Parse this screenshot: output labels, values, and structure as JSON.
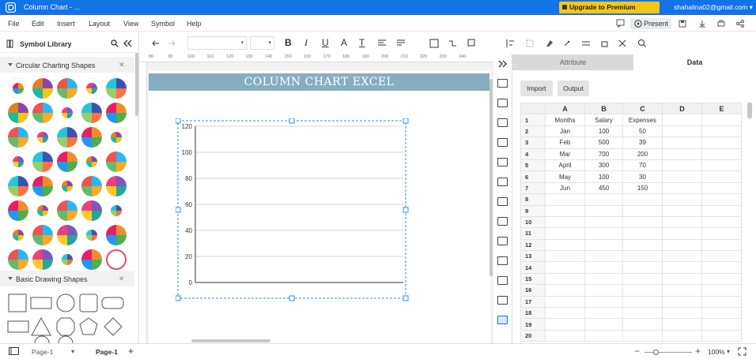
{
  "window": {
    "title": "Column Chart - ...",
    "premium_label": "Upgrade to Premium Version",
    "user_email": "shahalina02@gmail.com ▾"
  },
  "menu": [
    "File",
    "Edit",
    "Insert",
    "Layout",
    "View",
    "Symbol",
    "Help"
  ],
  "toolbar": {
    "present_label": "Present"
  },
  "symbol_library": {
    "title": "Symbol Library",
    "sections": [
      "Circular Charting Shapes",
      "Basic Drawing Shapes"
    ]
  },
  "canvas": {
    "banner_title": "COLUMN CHART EXCEL",
    "ruler_ticks": [
      "80",
      "90",
      "100",
      "110",
      "120",
      "130",
      "140",
      "150",
      "160",
      "170",
      "180",
      "190",
      "200",
      "210",
      "220",
      "230",
      "240"
    ]
  },
  "chart_data": {
    "type": "bar",
    "title": "",
    "categories": [],
    "series": [],
    "ylim": [
      0,
      120
    ],
    "yticks": [
      "120",
      "100",
      "80",
      "60",
      "40",
      "20",
      "0"
    ],
    "grid": true
  },
  "panel": {
    "tabs": [
      "Attribute",
      "Data"
    ],
    "import_label": "Import",
    "output_label": "Output",
    "columns": [
      "A",
      "B",
      "C",
      "D",
      "E"
    ],
    "rows": [
      [
        "Months",
        "Salary",
        "Expenses",
        "",
        ""
      ],
      [
        "Jan",
        "100",
        "50",
        "",
        ""
      ],
      [
        "Feb",
        "500",
        "39",
        "",
        ""
      ],
      [
        "Mar",
        "700",
        "200",
        "",
        ""
      ],
      [
        "April",
        "300",
        "70",
        "",
        ""
      ],
      [
        "May",
        "100",
        "30",
        "",
        ""
      ],
      [
        "Jun",
        "450",
        "150",
        "",
        ""
      ],
      [
        "",
        "",
        "",
        "",
        ""
      ],
      [
        "",
        "",
        "",
        "",
        ""
      ],
      [
        "",
        "",
        "",
        "",
        ""
      ],
      [
        "",
        "",
        "",
        "",
        ""
      ],
      [
        "",
        "",
        "",
        "",
        ""
      ],
      [
        "",
        "",
        "",
        "",
        ""
      ],
      [
        "",
        "",
        "",
        "",
        ""
      ],
      [
        "",
        "",
        "",
        "",
        ""
      ],
      [
        "",
        "",
        "",
        "",
        ""
      ],
      [
        "",
        "",
        "",
        "",
        ""
      ],
      [
        "",
        "",
        "",
        "",
        ""
      ],
      [
        "",
        "",
        "",
        "",
        ""
      ],
      [
        "",
        "",
        "",
        "",
        ""
      ]
    ]
  },
  "status": {
    "page_selector": "Page-1",
    "active_page": "Page-1",
    "add_page": "+",
    "zoom": "100%"
  }
}
